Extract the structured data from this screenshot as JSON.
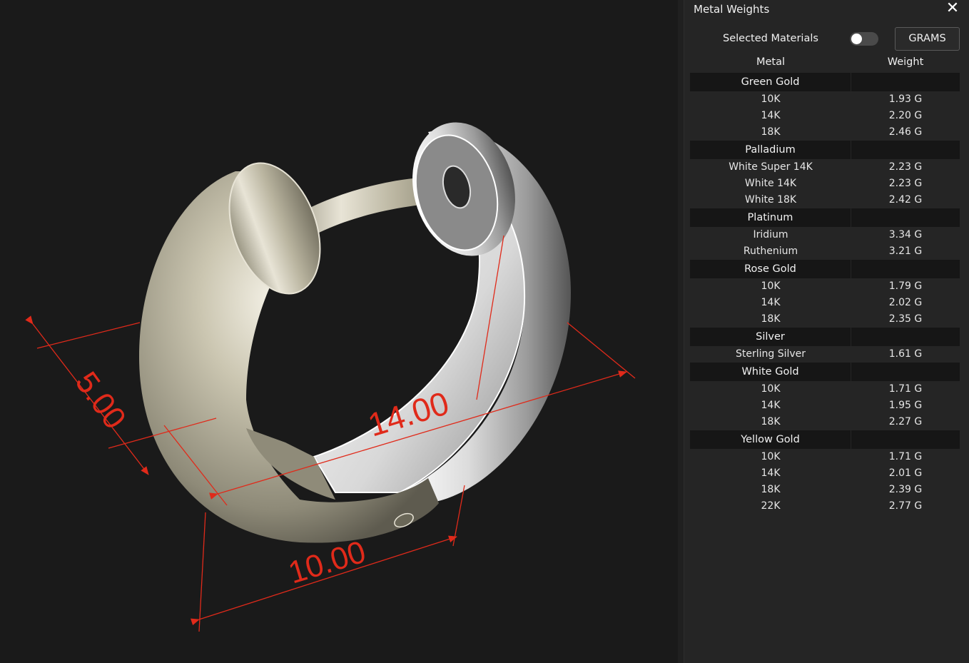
{
  "viewport": {
    "dimensions": [
      {
        "name": "width",
        "label": "5.00"
      },
      {
        "name": "diameter",
        "label": "14.00"
      },
      {
        "name": "depth",
        "label": "10.00"
      }
    ],
    "colors": {
      "background": "#1a1a1a",
      "dimension": "#e02a1a",
      "gold_metal": "#c9c4b0",
      "white_metal": "#e6e6e6"
    }
  },
  "panel": {
    "title": "Metal Weights",
    "close_icon": "close-icon",
    "selected_materials_label": "Selected Materials",
    "selected_materials_on": false,
    "unit_button": "GRAMS",
    "headers": {
      "metal": "Metal",
      "weight": "Weight"
    },
    "groups": [
      {
        "name": "Green Gold",
        "rows": [
          {
            "metal": "10K",
            "weight": "1.93 G"
          },
          {
            "metal": "14K",
            "weight": "2.20 G"
          },
          {
            "metal": "18K",
            "weight": "2.46 G"
          }
        ]
      },
      {
        "name": "Palladium",
        "rows": [
          {
            "metal": "White Super 14K",
            "weight": "2.23 G"
          },
          {
            "metal": "White 14K",
            "weight": "2.23 G"
          },
          {
            "metal": "White 18K",
            "weight": "2.42 G"
          }
        ]
      },
      {
        "name": "Platinum",
        "rows": [
          {
            "metal": "Iridium",
            "weight": "3.34 G"
          },
          {
            "metal": "Ruthenium",
            "weight": "3.21 G"
          }
        ]
      },
      {
        "name": "Rose Gold",
        "rows": [
          {
            "metal": "10K",
            "weight": "1.79 G"
          },
          {
            "metal": "14K",
            "weight": "2.02 G"
          },
          {
            "metal": "18K",
            "weight": "2.35 G"
          }
        ]
      },
      {
        "name": "Silver",
        "rows": [
          {
            "metal": "Sterling Silver",
            "weight": "1.61 G"
          }
        ]
      },
      {
        "name": "White Gold",
        "rows": [
          {
            "metal": "10K",
            "weight": "1.71 G"
          },
          {
            "metal": "14K",
            "weight": "1.95 G"
          },
          {
            "metal": "18K",
            "weight": "2.27 G"
          }
        ]
      },
      {
        "name": "Yellow Gold",
        "rows": [
          {
            "metal": "10K",
            "weight": "1.71 G"
          },
          {
            "metal": "14K",
            "weight": "2.01 G"
          },
          {
            "metal": "18K",
            "weight": "2.39 G"
          },
          {
            "metal": "22K",
            "weight": "2.77 G"
          }
        ]
      }
    ]
  }
}
